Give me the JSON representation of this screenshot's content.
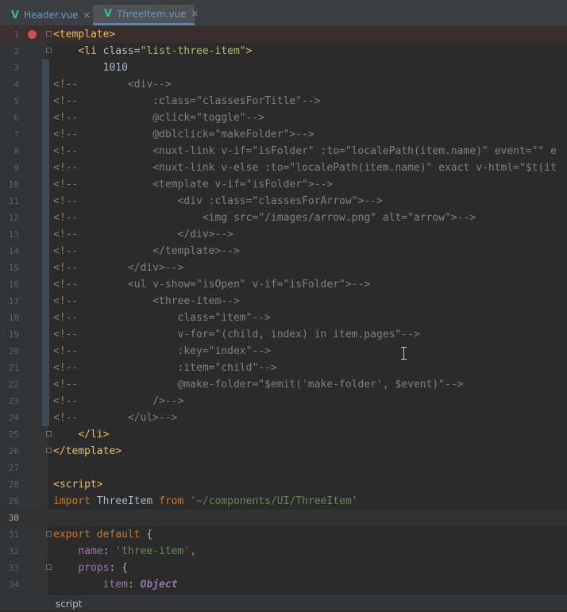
{
  "tabs": [
    {
      "label": "Header.vue",
      "icon": "vue-icon",
      "active": false
    },
    {
      "label": "ThreeItem.vue",
      "icon": "vue-icon",
      "active": true
    }
  ],
  "close_glyph": "✕",
  "vue_glyph": "V",
  "colors": {
    "tag": "#e8bf6a",
    "attribute": "#bababa",
    "string": "#a5c25c",
    "comment": "#808080",
    "keyword": "#cc7832",
    "breakpoint": "#c75450",
    "vue_icon": "#41b883"
  },
  "editor": {
    "lines": [
      {
        "n": "1",
        "segs": [
          [
            "tag",
            "<template>"
          ]
        ]
      },
      {
        "n": "2",
        "segs": [
          [
            "plain",
            "    "
          ],
          [
            "tag",
            "<li "
          ],
          [
            "attr",
            "class="
          ],
          [
            "str",
            "\"list-three-item\""
          ],
          [
            "tag",
            ">"
          ]
        ]
      },
      {
        "n": "3",
        "segs": [
          [
            "plain",
            "        1010"
          ]
        ]
      },
      {
        "n": "4",
        "segs": [
          [
            "cmt",
            "<!--        <div-->"
          ]
        ]
      },
      {
        "n": "5",
        "segs": [
          [
            "cmt",
            "<!--            :class=\"classesForTitle\"-->"
          ]
        ]
      },
      {
        "n": "6",
        "segs": [
          [
            "cmt",
            "<!--            @click=\"toggle\"-->"
          ]
        ]
      },
      {
        "n": "7",
        "segs": [
          [
            "cmt",
            "<!--            @dblclick=\"makeFolder\">-->"
          ]
        ]
      },
      {
        "n": "8",
        "segs": [
          [
            "cmt",
            "<!--            <nuxt-link v-if=\"isFolder\" :to=\"localePath(item.name)\" event=\"\" e"
          ]
        ]
      },
      {
        "n": "9",
        "segs": [
          [
            "cmt",
            "<!--            <nuxt-link v-else :to=\"localePath(item.name)\" exact v-html=\"$t(it"
          ]
        ]
      },
      {
        "n": "10",
        "segs": [
          [
            "cmt",
            "<!--            <template v-if=\"isFolder\">-->"
          ]
        ]
      },
      {
        "n": "11",
        "segs": [
          [
            "cmt",
            "<!--                <div :class=\"classesForArrow\">-->"
          ]
        ]
      },
      {
        "n": "12",
        "segs": [
          [
            "cmt",
            "<!--                    <img src=\"/images/arrow.png\" alt=\"arrow\">-->"
          ]
        ]
      },
      {
        "n": "13",
        "segs": [
          [
            "cmt",
            "<!--                </div>-->"
          ]
        ]
      },
      {
        "n": "14",
        "segs": [
          [
            "cmt",
            "<!--            </template>-->"
          ]
        ]
      },
      {
        "n": "15",
        "segs": [
          [
            "cmt",
            "<!--        </div>-->"
          ]
        ]
      },
      {
        "n": "16",
        "segs": [
          [
            "cmt",
            "<!--        <ul v-show=\"isOpen\" v-if=\"isFolder\">-->"
          ]
        ]
      },
      {
        "n": "17",
        "segs": [
          [
            "cmt",
            "<!--            <three-item-->"
          ]
        ]
      },
      {
        "n": "18",
        "segs": [
          [
            "cmt",
            "<!--                class=\"item\"-->"
          ]
        ]
      },
      {
        "n": "19",
        "segs": [
          [
            "cmt",
            "<!--                v-for=\"(child, index) in item.pages\"-->"
          ]
        ]
      },
      {
        "n": "20",
        "segs": [
          [
            "cmt",
            "<!--                :key=\"index\"-->"
          ]
        ]
      },
      {
        "n": "21",
        "segs": [
          [
            "cmt",
            "<!--                :item=\"child\"-->"
          ]
        ]
      },
      {
        "n": "22",
        "segs": [
          [
            "cmt",
            "<!--                @make-folder=\"$emit('make-folder', $event)\"-->"
          ]
        ]
      },
      {
        "n": "23",
        "segs": [
          [
            "cmt",
            "<!--            />-->"
          ]
        ]
      },
      {
        "n": "24",
        "segs": [
          [
            "cmt",
            "<!--        </ul>-->"
          ]
        ]
      },
      {
        "n": "25",
        "segs": [
          [
            "plain",
            "    "
          ],
          [
            "tag",
            "</li>"
          ]
        ]
      },
      {
        "n": "26",
        "segs": [
          [
            "tag",
            "</template>"
          ]
        ]
      },
      {
        "n": "27",
        "segs": []
      },
      {
        "n": "28",
        "segs": [
          [
            "tag",
            "<script>"
          ]
        ]
      },
      {
        "n": "29",
        "segs": [
          [
            "kw",
            "import "
          ],
          [
            "ident",
            "ThreeItem "
          ],
          [
            "kw",
            "from "
          ],
          [
            "strjs",
            "'~/components/UI/ThreeItem'"
          ]
        ]
      },
      {
        "n": "30",
        "segs": []
      },
      {
        "n": "31",
        "segs": [
          [
            "kw",
            "export default "
          ],
          [
            "ident",
            "{"
          ]
        ]
      },
      {
        "n": "32",
        "segs": [
          [
            "plain",
            "    "
          ],
          [
            "prop",
            "name"
          ],
          [
            "ident",
            ": "
          ],
          [
            "strjs",
            "'three-item'"
          ],
          [
            "kw",
            ","
          ]
        ]
      },
      {
        "n": "33",
        "segs": [
          [
            "plain",
            "    "
          ],
          [
            "prop",
            "props"
          ],
          [
            "ident",
            ": {"
          ]
        ]
      },
      {
        "n": "34",
        "segs": [
          [
            "plain",
            "        "
          ],
          [
            "prop",
            "item"
          ],
          [
            "ident",
            ": "
          ],
          [
            "type",
            "Object"
          ]
        ]
      }
    ]
  },
  "status": {
    "breadcrumb": "script"
  }
}
